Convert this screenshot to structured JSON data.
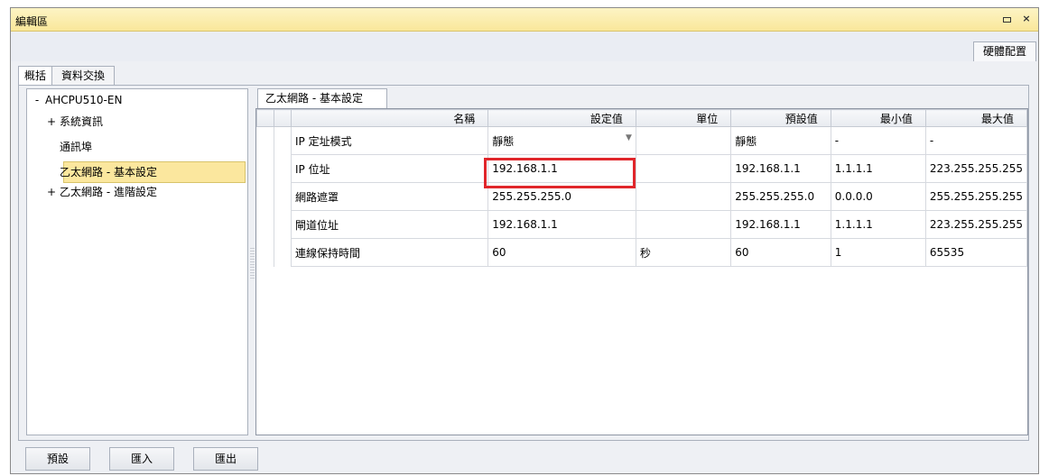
{
  "window": {
    "title": "編輯區"
  },
  "right_tab": "硬體配置",
  "tabs": [
    "概括",
    "資料交換"
  ],
  "tree": {
    "root": "AHCPU510-EN",
    "items": [
      "系統資訊",
      "通訊埠",
      "乙太網路 - 基本設定",
      "乙太網路 - 進階設定"
    ],
    "selected": "乙太網路 - 基本設定"
  },
  "subtab": "乙太網路 - 基本設定",
  "grid": {
    "headers": [
      "名稱",
      "設定值",
      "單位",
      "預設值",
      "最小值",
      "最大值"
    ],
    "rows": [
      [
        "IP 定址模式",
        "靜態",
        "",
        "靜態",
        "-",
        "-"
      ],
      [
        "IP 位址",
        "192.168.1.1",
        "",
        "192.168.1.1",
        "1.1.1.1",
        "223.255.255.255"
      ],
      [
        "網路遮罩",
        "255.255.255.0",
        "",
        "255.255.255.0",
        "0.0.0.0",
        "255.255.255.255"
      ],
      [
        "閘道位址",
        "192.168.1.1",
        "",
        "192.168.1.1",
        "1.1.1.1",
        "223.255.255.255"
      ],
      [
        "連線保持時間",
        "60",
        "秒",
        "60",
        "1",
        "65535"
      ]
    ]
  },
  "buttons": {
    "default": "預設",
    "import": "匯入",
    "export": "匯出"
  },
  "colors": {
    "highlight": "#e0262b",
    "title_bar": "#f9e79a",
    "selection": "#fbe79e"
  }
}
